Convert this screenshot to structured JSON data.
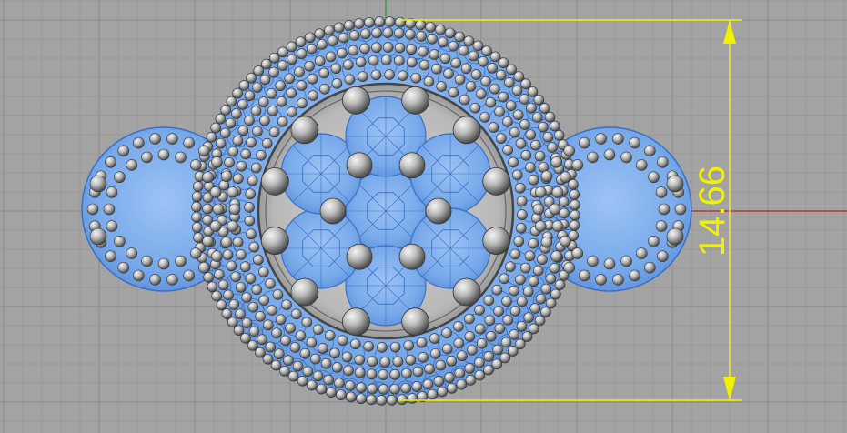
{
  "viewport": {
    "background": "#a3a3a3",
    "grid_minor_color": "#989898",
    "grid_major_color": "#8a8a8a",
    "axis_x_color": "#b42828",
    "axis_y_color": "#1f9a2f"
  },
  "model": {
    "description_icon": "ring-top-view-icon",
    "metal_color": "#a8a8a8",
    "gem_color": "#6fa3e8",
    "gem_wire_color": "#3a6fc4"
  },
  "dimension": {
    "value": "14.66",
    "color": "#f2f200"
  }
}
